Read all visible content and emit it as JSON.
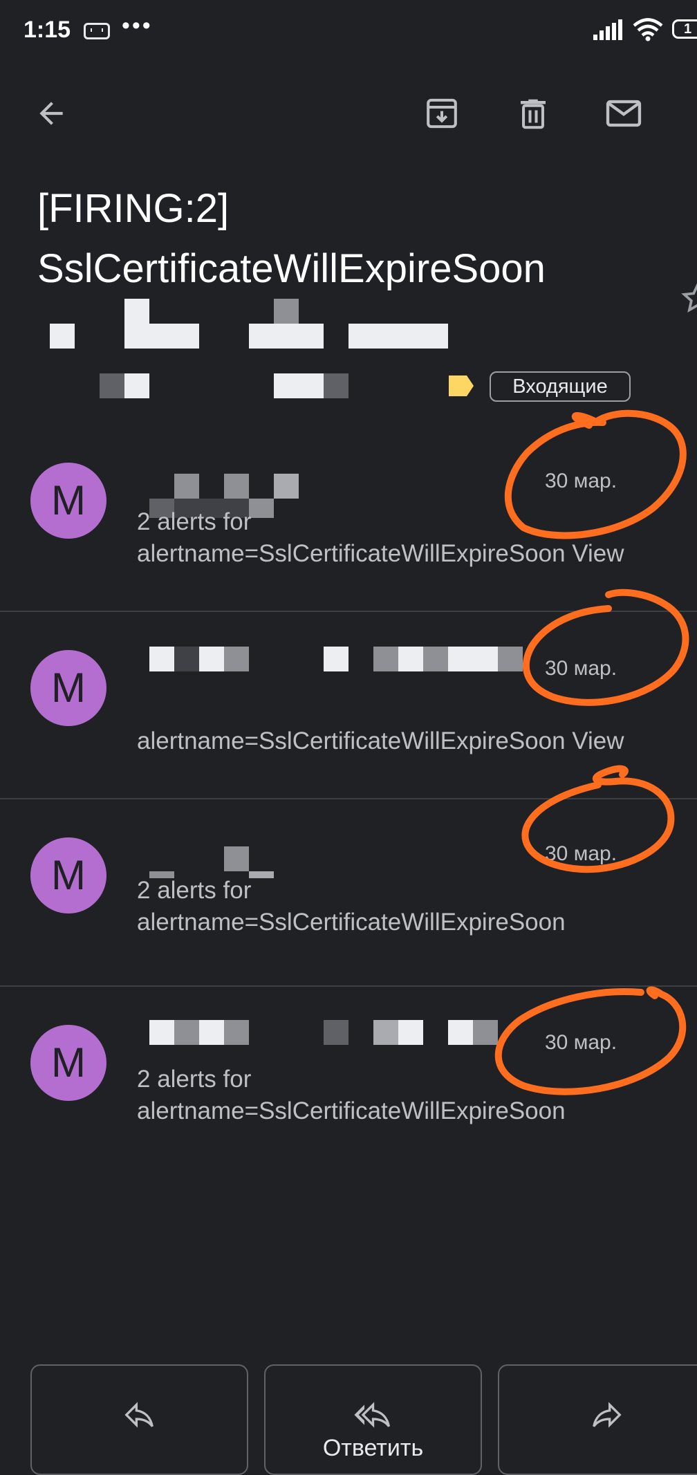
{
  "status_bar": {
    "time": "1:15",
    "battery": "1"
  },
  "toolbar": {
    "back_icon": "arrow-left-icon",
    "archive_icon": "archive-icon",
    "delete_icon": "trash-icon",
    "unread_icon": "mail-icon"
  },
  "subject": {
    "line1": "[FIRING:2]",
    "line2": "SslCertificateWillExpireSoon"
  },
  "label": {
    "name": "Входящие",
    "color": "#fdd663"
  },
  "messages": [
    {
      "avatar_letter": "M",
      "date": "30 мар.",
      "snippet_line1": "2 alerts for",
      "snippet_line2": "alertname=SslCertificateWillExpireSoon View"
    },
    {
      "avatar_letter": "M",
      "date": "30 мар.",
      "snippet_line1": "",
      "snippet_line2": "alertname=SslCertificateWillExpireSoon View"
    },
    {
      "avatar_letter": "M",
      "date": "30 мар.",
      "snippet_line1": "2 alerts for",
      "snippet_line2": "alertname=SslCertificateWillExpireSoon"
    },
    {
      "avatar_letter": "M",
      "date": "30 мар.",
      "snippet_line1": "2 alerts for",
      "snippet_line2": "alertname=SslCertificateWillExpireSoon"
    }
  ],
  "actions": {
    "reply_all_label": "Ответить"
  },
  "colors": {
    "background": "#202124",
    "avatar": "#b46ed0",
    "annotation": "#ff6d1f"
  }
}
